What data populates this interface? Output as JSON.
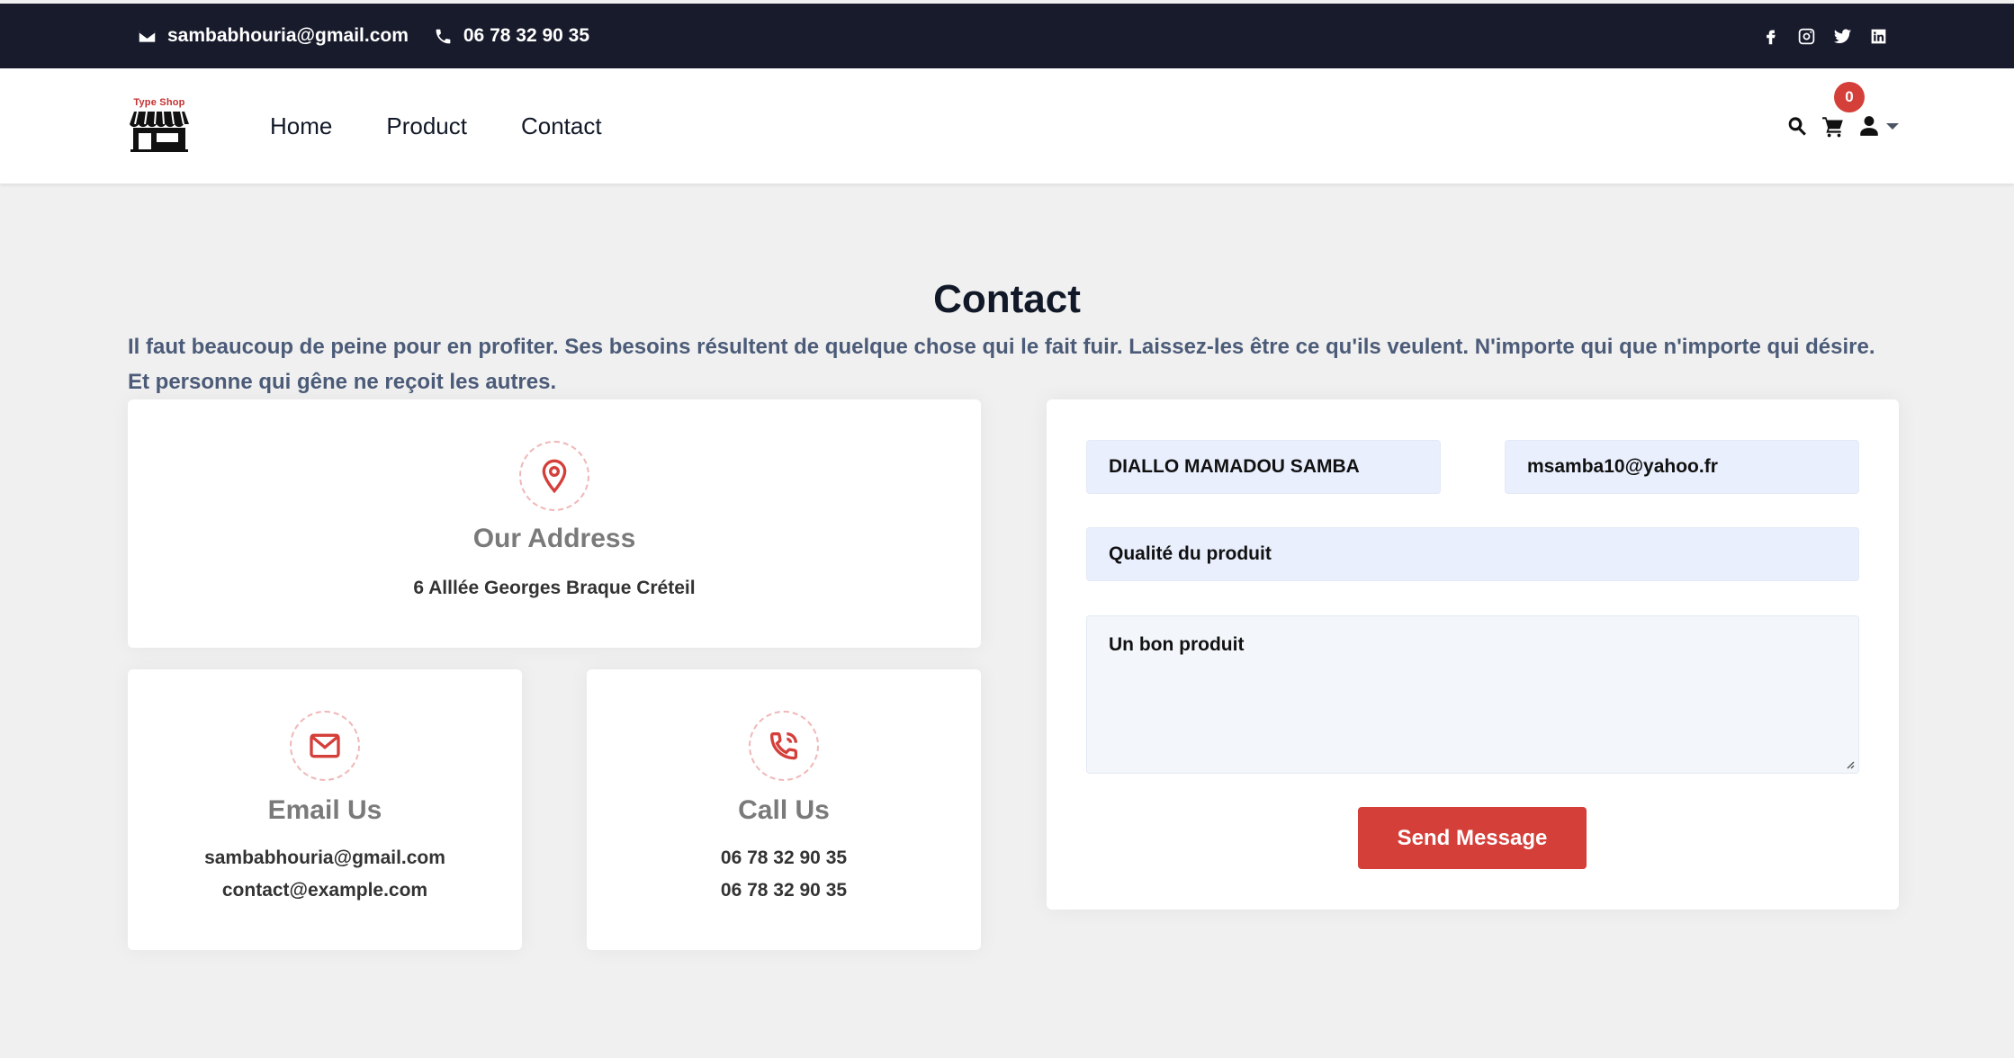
{
  "topbar": {
    "email": "sambabhouria@gmail.com",
    "phone": "06 78 32 90 35",
    "socials": [
      "facebook-icon",
      "instagram-icon",
      "twitter-icon",
      "linkedin-icon"
    ]
  },
  "navbar": {
    "logo_text": "Type Shop",
    "links": [
      "Home",
      "Product",
      "Contact"
    ],
    "cart_count": "0"
  },
  "contact": {
    "title": "Contact",
    "intro": "Il faut beaucoup de peine pour en profiter. Ses besoins résultent de quelque chose qui le fait fuir. Laissez-les être ce qu'ils veulent. N'importe qui que n'importe qui désire. Et personne qui gêne ne reçoit les autres.",
    "address": {
      "title": "Our Address",
      "line": "6 Alllée Georges Braque Créteil"
    },
    "email": {
      "title": "Email Us",
      "line1": "sambabhouria@gmail.com",
      "line2": "contact@example.com"
    },
    "call": {
      "title": "Call Us",
      "line1": "06 78 32 90 35",
      "line2": "06 78 32 90 35"
    }
  },
  "form": {
    "name_value": "DIALLO MAMADOU SAMBA",
    "email_value": "msamba10@yahoo.fr",
    "subject_value": "Qualité du produit",
    "message_value": "Un bon produit",
    "submit_label": "Send Message"
  },
  "colors": {
    "accent": "#d43f3a",
    "topbar_bg": "#181b2c",
    "page_bg": "#f0f0f0",
    "field_bg": "#e9effd"
  }
}
